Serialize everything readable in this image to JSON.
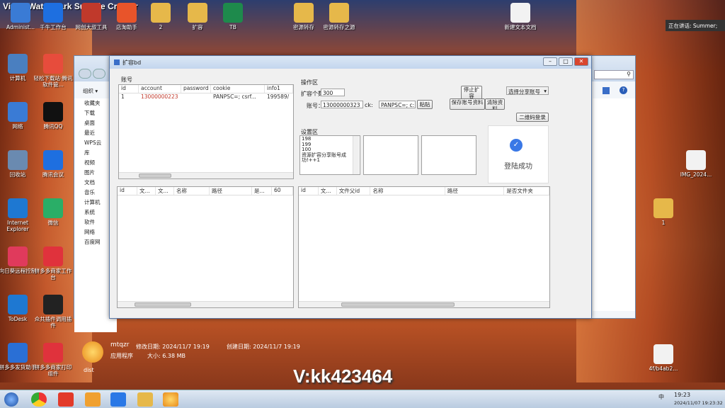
{
  "watermark": "Video Watermark Subtitle Creator",
  "bottom_watermark": "V:kk423464",
  "notice": "正在讲话: Summer;",
  "desktop_icons": [
    {
      "label": "Administ...",
      "icon": "user-icon",
      "color": "#3a7bd5"
    },
    {
      "label": "千牛工作台",
      "icon": "qianniu-icon",
      "color": "#1e6fe0"
    },
    {
      "label": "网创大叔工具",
      "icon": "tool-icon",
      "color": "#c0392b"
    },
    {
      "label": "店淘助手",
      "icon": "shop-icon",
      "color": "#e8542a"
    },
    {
      "label": "2",
      "icon": "folder-icon",
      "color": "#e6b84a"
    },
    {
      "label": "扩容",
      "icon": "folder-icon",
      "color": "#e6b84a"
    },
    {
      "label": "TB",
      "icon": "excel-icon",
      "color": "#1e8a4c"
    },
    {
      "label": "密源转存",
      "icon": "folder-icon",
      "color": "#e6b84a"
    },
    {
      "label": "密源转存之源",
      "icon": "folder-icon",
      "color": "#e6b84a"
    },
    {
      "label": "新建文本文档",
      "icon": "text-file-icon",
      "color": "#f2f2f2"
    }
  ],
  "left_icons": [
    {
      "label": "计算机",
      "icon": "computer-icon",
      "color": "#4a7fc0"
    },
    {
      "label": "轻松下载站·腾讯软件管...",
      "icon": "colorful-icon",
      "color": "#e74c3c"
    },
    {
      "label": "网络",
      "icon": "network-icon",
      "color": "#3a7bd5"
    },
    {
      "label": "腾讯QQ",
      "icon": "qq-icon",
      "color": "#111"
    },
    {
      "label": "回收站",
      "icon": "recycle-bin-icon",
      "color": "#6a8ab0"
    },
    {
      "label": "腾讯会议",
      "icon": "meeting-icon",
      "color": "#1e6fe0"
    },
    {
      "label": "Internet Explorer",
      "icon": "ie-icon",
      "color": "#1e78d2"
    },
    {
      "label": "微信",
      "icon": "wechat-icon",
      "color": "#2aae67"
    },
    {
      "label": "向日葵远程控制",
      "icon": "sunflower-icon",
      "color": "#e03a5c"
    },
    {
      "label": "拼多多商家工作台",
      "icon": "pdd-icon",
      "color": "#e0323c"
    },
    {
      "label": "ToDesk",
      "icon": "todesk-icon",
      "color": "#1e78d2"
    },
    {
      "label": "众共插件调用插件",
      "icon": "plugin-icon",
      "color": "#222"
    },
    {
      "label": "拼多多发货助手",
      "icon": "grid-icon",
      "color": "#2a6fd5"
    },
    {
      "label": "拼多多商家打印组件",
      "icon": "pdd-icon",
      "color": "#e0323c"
    }
  ],
  "right_icons": [
    {
      "label": "IMG_2024...",
      "icon": "image-icon",
      "color": "#f2f2f2"
    },
    {
      "label": "1",
      "icon": "folder-icon",
      "color": "#e6b84a"
    },
    {
      "label": "4f/b4ab2...",
      "icon": "image-icon",
      "color": "#f2f2f2"
    }
  ],
  "explorer": {
    "organize": "组织 ▾",
    "nav": [
      "收藏夹",
      "下载",
      "桌面",
      "最近",
      "WPS云",
      "库",
      "视频",
      "图片",
      "文档",
      "音乐",
      "计算机",
      "系统",
      "软件",
      "网络",
      "百度网"
    ],
    "file_name": "mtqzr",
    "modified": "修改日期: 2024/11/7 19:19",
    "created": "创建日期: 2024/11/7 19:19",
    "type": "应用程序",
    "size": "大小: 6.38 MB",
    "dist": "dist"
  },
  "app": {
    "title": "扩容bd",
    "account_section": "账号",
    "account_cols": [
      "id",
      "account",
      "password",
      "cookie",
      "info1"
    ],
    "account_rows": [
      [
        "1",
        "13000000223",
        "",
        "PANPSC=; csrf...",
        "199589/"
      ]
    ],
    "op_section": "操作区",
    "expand_count_label": "扩容个数",
    "expand_count": "300",
    "account_label": "账号：",
    "account_value": "13000000323",
    "ck_label": "ck:",
    "ck_value": "PANPSC=; c:",
    "paste_btn": "粘贴",
    "stop_btn": "停止扩容",
    "save_btn": "保存账号资料",
    "clear_btn": "清除资料",
    "share_select": "选择分享账号",
    "qr_btn": "二维码登录",
    "settings_section": "设置区",
    "log_lines": [
      "198",
      "199",
      "100",
      "资源扩容分享账号成",
      "功!++1"
    ],
    "login_status": "登陆成功",
    "left_cols": [
      "id",
      "文...",
      "文...",
      "名称",
      "路径",
      "是...",
      "60"
    ],
    "right_cols": [
      "id",
      "文...",
      "文件父id",
      "名称",
      "路径",
      "是否文件夹"
    ]
  },
  "taskbar": {
    "time": "19:23",
    "date": "2024/11/07 19:23:32",
    "ime": "中"
  }
}
